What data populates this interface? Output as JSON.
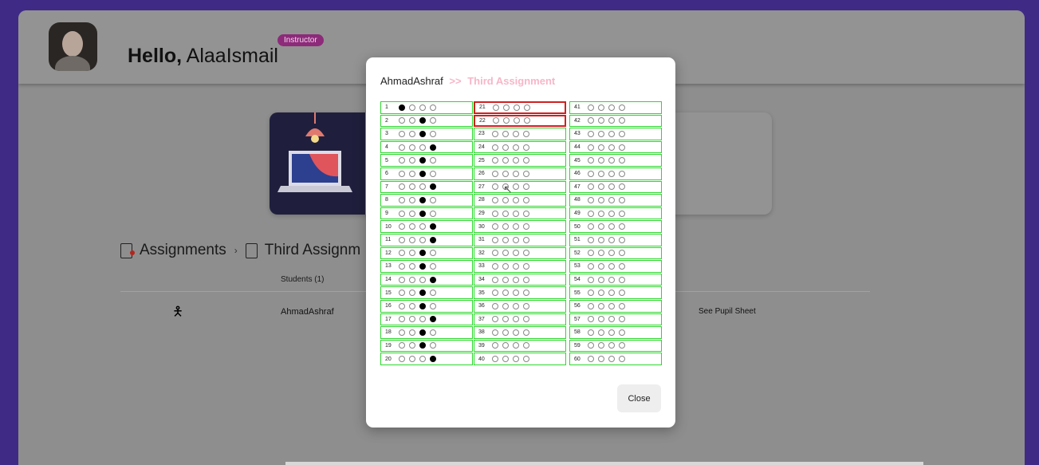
{
  "header": {
    "greeting": "Hello,",
    "username": "AlaaIsmail",
    "role": "Instructor"
  },
  "breadcrumb": {
    "assignments": "Assignments",
    "current": "Third Assignm"
  },
  "table": {
    "students_header": "Students (1)",
    "rows": [
      {
        "name": "AhmadAshraf",
        "action": "See Pupil Sheet"
      }
    ]
  },
  "modal": {
    "student": "AhmadAshraf",
    "separator": ">>",
    "assignment": "Third Assignment",
    "close_label": "Close",
    "columns": [
      {
        "labels": [
          "1",
          "2",
          "3",
          "4",
          "5",
          "6",
          "7",
          "8",
          "9",
          "10",
          "11",
          "12",
          "13",
          "14",
          "15",
          "16",
          "17",
          "18",
          "19",
          "20"
        ],
        "filled": [
          0,
          2,
          2,
          3,
          2,
          2,
          3,
          2,
          2,
          3,
          3,
          2,
          2,
          3,
          2,
          2,
          3,
          2,
          2,
          3
        ]
      },
      {
        "labels": [
          "21",
          "22",
          "23",
          "24",
          "25",
          "26",
          "27",
          "28",
          "29",
          "30",
          "31",
          "32",
          "33",
          "34",
          "35",
          "36",
          "37",
          "38",
          "39",
          "40"
        ],
        "filled": [
          -1,
          -1,
          -1,
          -1,
          -1,
          -1,
          -1,
          -1,
          -1,
          -1,
          -1,
          -1,
          -1,
          -1,
          -1,
          -1,
          -1,
          -1,
          -1,
          -1
        ]
      },
      {
        "labels": [
          "41",
          "42",
          "43",
          "44",
          "45",
          "46",
          "47",
          "48",
          "49",
          "50",
          "51",
          "52",
          "53",
          "54",
          "55",
          "56",
          "57",
          "58",
          "59",
          "60"
        ],
        "filled": [
          -1,
          -1,
          -1,
          -1,
          -1,
          -1,
          -1,
          -1,
          -1,
          -1,
          -1,
          -1,
          -1,
          -1,
          -1,
          -1,
          -1,
          -1,
          -1,
          -1
        ]
      }
    ],
    "wrong_questions": [
      "21",
      "22"
    ]
  },
  "colors": {
    "correct_border": "#2bd82b",
    "wrong_border": "#d02020",
    "accent_pink": "#f7b6c8",
    "badge": "#8d2a7a"
  }
}
